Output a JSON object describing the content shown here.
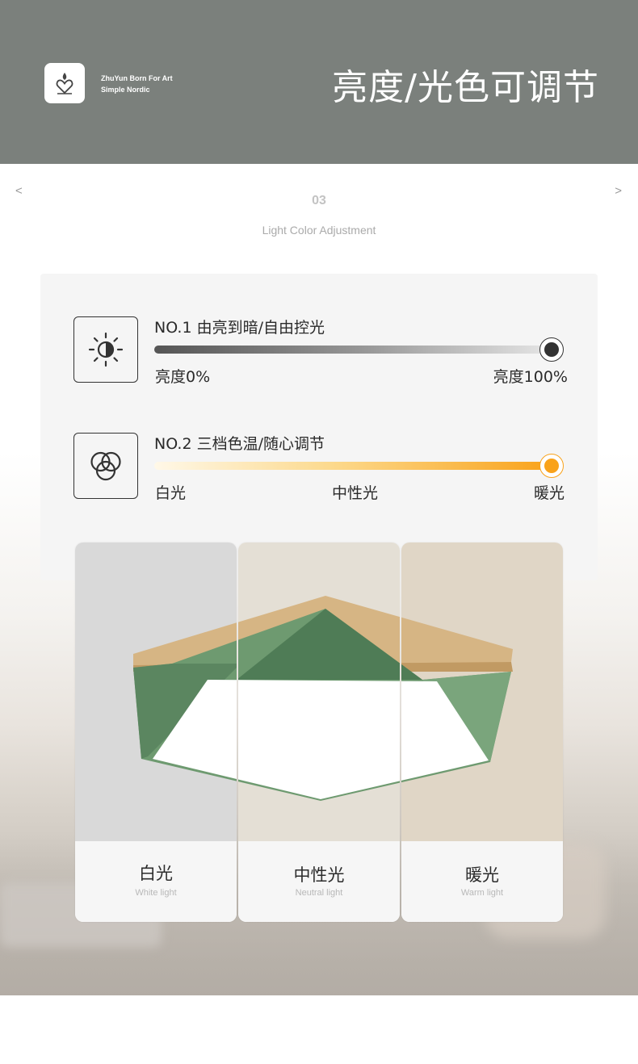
{
  "header": {
    "brand_line1": "ZhuYun Born For Art",
    "brand_line2": "Simple Nordic",
    "title": "亮度/光色可调节",
    "logo_icon": "flame-heart-icon",
    "background_color": "#7b807c"
  },
  "section": {
    "prev_arrow": "<",
    "next_arrow": ">",
    "number": "03",
    "subtitle": "Light Color Adjustment"
  },
  "controls": [
    {
      "icon": "sun-brightness-icon",
      "label": "NO.1  由亮到暗/自由控光",
      "start_label": "亮度0%",
      "end_label": "亮度100%",
      "slider_value": 1.0,
      "track_colors": [
        "#555555",
        "#e6e6e6"
      ],
      "knob_color": "#333333"
    },
    {
      "icon": "color-circles-icon",
      "label": "NO.2  三档色温/随心调节",
      "start_label": "白光",
      "mid_label": "中性光",
      "end_label": "暖光",
      "slider_value": 1.0,
      "track_colors": [
        "#fff8e8",
        "#f9a21a"
      ],
      "knob_color": "#f9a21a"
    }
  ],
  "cards": [
    {
      "title": "白光",
      "subtitle": "White light",
      "tone": "#dcdcdc"
    },
    {
      "title": "中性光",
      "subtitle": "Neutral light",
      "tone": "#e6e1d8"
    },
    {
      "title": "暖光",
      "subtitle": "Warm light",
      "tone": "#e2d7c6"
    }
  ],
  "lamp_colors": {
    "shade": "#6f9a6f",
    "wood": "#d8b888",
    "diffuser": "#ffffff"
  }
}
